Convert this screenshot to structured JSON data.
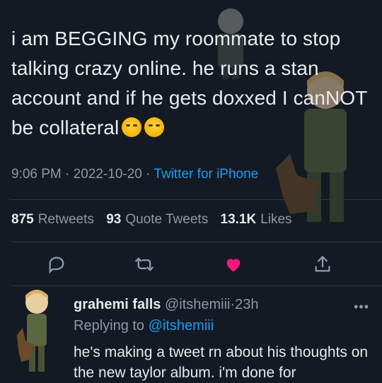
{
  "tweet": {
    "text_before_emoji": "i am BEGGING my roommate to stop talking crazy online. he runs a stan account and if he gets doxxed I canNOT be collateral",
    "emoji_1": "crying-face-emoji",
    "emoji_2": "crying-face-emoji",
    "time": "9:06 PM",
    "date": "2022-10-20",
    "separator": "·",
    "source": "Twitter for iPhone"
  },
  "stats": {
    "retweets_count": "875",
    "retweets_label": "Retweets",
    "quotes_count": "93",
    "quotes_label": "Quote Tweets",
    "likes_count": "13.1K",
    "likes_label": "Likes"
  },
  "actions": {
    "reply_icon": "reply-icon",
    "retweet_icon": "retweet-icon",
    "like_icon": "heart-icon",
    "share_icon": "share-icon",
    "like_color": "#f91880"
  },
  "reply": {
    "display_name": "grahemi falls",
    "handle": "@itshemiii",
    "separator": "·",
    "age": "23h",
    "replying_prefix": "Replying to",
    "replying_handle": "@itshemiii",
    "text": "he's making a tweet rn about his thoughts on the new taylor album. i'm done for",
    "more_icon": "more-icon"
  },
  "colors": {
    "background": "#141a23",
    "text": "#e7e9ea",
    "muted": "#8b98a5",
    "link": "#1d9bf0"
  }
}
